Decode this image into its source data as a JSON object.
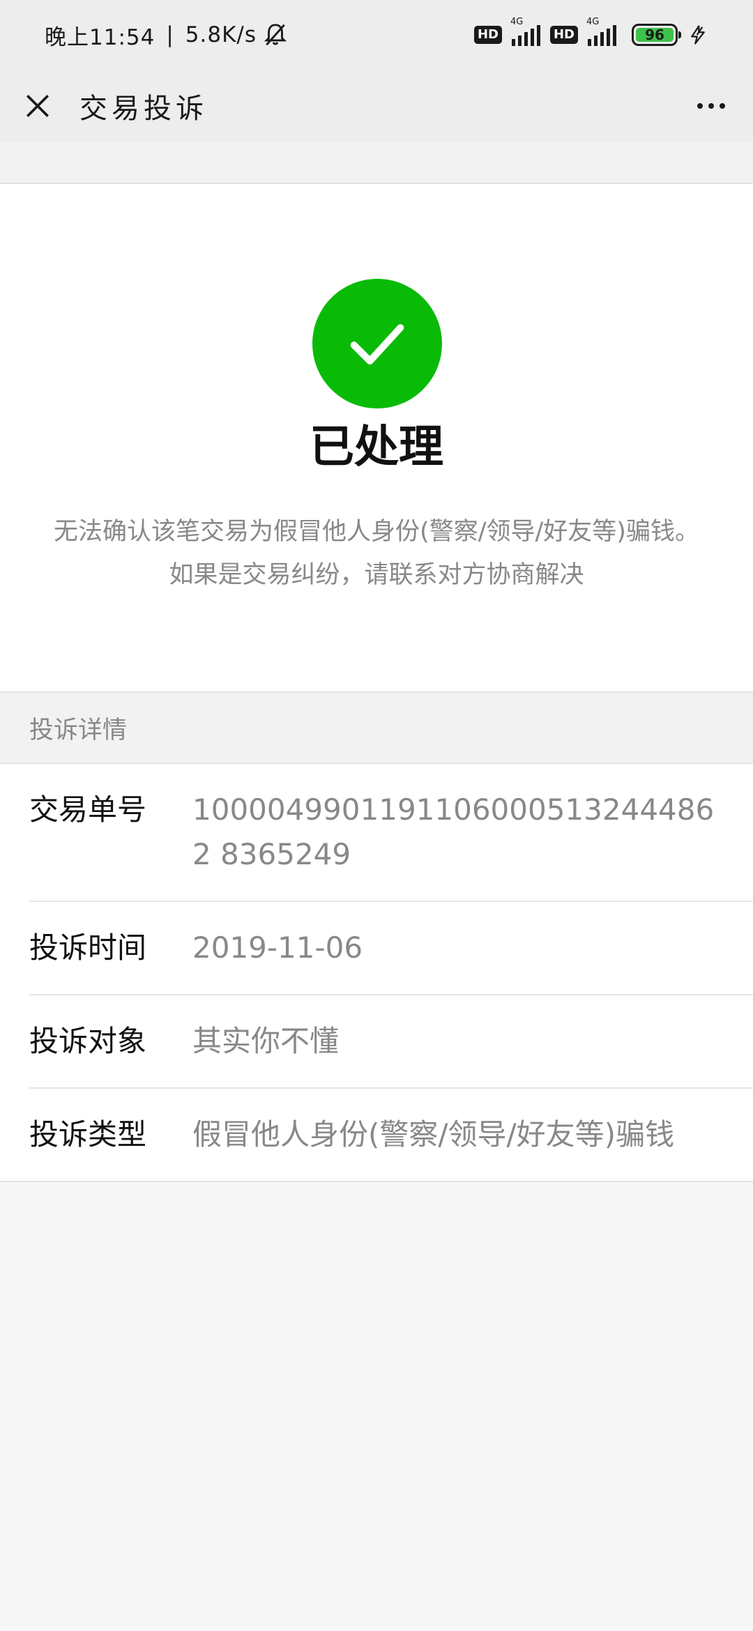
{
  "status_bar": {
    "time": "晚上11:54",
    "speed": "5.8K/s",
    "hd_label": "HD",
    "network_label": "4G",
    "battery": "96"
  },
  "nav": {
    "title": "交易投诉"
  },
  "result": {
    "title": "已处理",
    "description": "无法确认该笔交易为假冒他人身份(警察/领导/好友等)骗钱。如果是交易纠纷，请联系对方协商解决",
    "icon_color": "#09bb07"
  },
  "details": {
    "header": "投诉详情",
    "rows": [
      {
        "label": "交易单号",
        "value": "10000499011911060005132444862 8365249"
      },
      {
        "label": "投诉时间",
        "value": "2019-11-06"
      },
      {
        "label": "投诉对象",
        "value": "其实你不懂"
      },
      {
        "label": "投诉类型",
        "value": "假冒他人身份(警察/领导/好友等)骗钱"
      }
    ]
  }
}
